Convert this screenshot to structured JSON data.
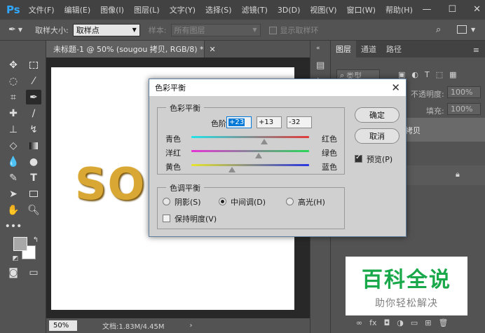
{
  "app": {
    "logo": "Ps",
    "menu": [
      "文件(F)",
      "编辑(E)",
      "图像(I)",
      "图层(L)",
      "文字(Y)",
      "选择(S)",
      "滤镜(T)",
      "3D(D)",
      "视图(V)",
      "窗口(W)",
      "帮助(H)"
    ],
    "window_controls": [
      "—",
      "☐",
      "✕"
    ]
  },
  "options": {
    "sample_size_label": "取样大小:",
    "sample_size_value": "取样点",
    "sample_label": "样本:",
    "sample_value": "所有图层",
    "show_ring_label": "显示取样环"
  },
  "document": {
    "tab_title": "未标题-1 @ 50% (sougou 拷贝, RGB/8) *",
    "canvas_text": "SOU",
    "zoom": "50%",
    "doc_info": "文档:1.83M/4.45M"
  },
  "layers_panel": {
    "tabs": [
      "图层",
      "通道",
      "路径"
    ],
    "kind_label": "类型",
    "opacity_label": "不透明度:",
    "opacity_value": "100%",
    "fill_label": "填充:",
    "fill_value": "100%",
    "selected_layer_name": "拷贝"
  },
  "dialog": {
    "title": "色彩平衡",
    "color_balance_group": "色彩平衡",
    "levels_label": "色阶(L):",
    "levels": [
      "+23",
      "+13",
      "-32"
    ],
    "sliders": [
      {
        "left": "青色",
        "right": "红色",
        "value": 23
      },
      {
        "left": "洋红",
        "right": "绿色",
        "value": 13
      },
      {
        "left": "黄色",
        "right": "蓝色",
        "value": -32
      }
    ],
    "tone_balance_group": "色调平衡",
    "tones": [
      "阴影(S)",
      "中间调(D)",
      "高光(H)"
    ],
    "tone_selected": "中间调(D)",
    "preserve_luminosity": "保持明度(V)",
    "ok": "确定",
    "cancel": "取消",
    "preview": "预览(P)"
  },
  "watermark": {
    "big": "百科全说",
    "small": "助你轻松解决"
  },
  "colors": {
    "ps_blue": "#31a8ff",
    "canvas_text": "#d9a734",
    "watermark_green": "#19a84a"
  }
}
